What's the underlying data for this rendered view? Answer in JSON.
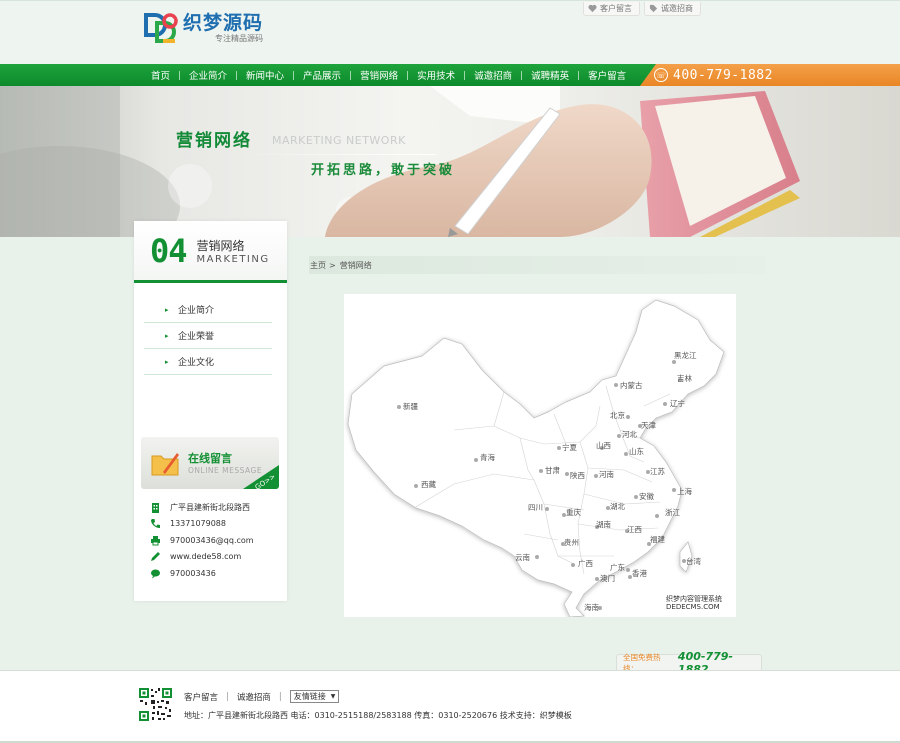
{
  "header": {
    "logo_title": "织梦源码",
    "logo_sub": "专注精品源码",
    "toplinks": [
      "客户留言",
      "诚邀招商"
    ]
  },
  "nav": {
    "items": [
      "首页",
      "企业简介",
      "新闻中心",
      "产品展示",
      "营销网络",
      "实用技术",
      "诚邀招商",
      "诚聘精英",
      "客户留言"
    ],
    "phone": "400-779-1882"
  },
  "banner": {
    "title": "营销网络",
    "title_en": "MARKETING NETWORK",
    "slogan": "开拓思路，敢于突破"
  },
  "sidebar": {
    "number": "04",
    "head_cn": "营销网络",
    "head_en": "MARKETING",
    "menu": [
      "企业简介",
      "企业荣誉",
      "企业文化"
    ],
    "message_cn": "在线留言",
    "message_en": "ONLINE MESSAGE",
    "message_go": "GO>>",
    "contact": {
      "address": "广平县建新街北段路西",
      "phone": "13371079088",
      "email": "970003436@qq.com",
      "website": "www.dede58.com",
      "qq": "970003436"
    }
  },
  "breadcrumb": {
    "home": "主页",
    "sep": ">",
    "current": "营销网络"
  },
  "map": {
    "provinces": [
      "黑龙江",
      "吉林",
      "辽宁",
      "内蒙古",
      "北京",
      "天津",
      "河北",
      "山西",
      "山东",
      "新疆",
      "青海",
      "宁夏",
      "甘肃",
      "陕西",
      "河南",
      "江苏",
      "西藏",
      "四川",
      "重庆",
      "湖北",
      "安徽",
      "上海",
      "湖南",
      "江西",
      "浙江",
      "福建",
      "贵州",
      "云南",
      "广西",
      "广东",
      "台湾",
      "澳门",
      "香港",
      "海南"
    ],
    "watermark_line1": "织梦内容管理系统",
    "watermark_line2": "DEDECMS.COM"
  },
  "footer": {
    "phone_label": "全国免费热线：",
    "phone": "400-779-1882",
    "links": [
      "客户留言",
      "诚邀招商"
    ],
    "select_label": "友情链接",
    "address_line": "地址：广平县建新街北段路西 电话：0310-2515188/2583188 传真：0310-2520676 技术支持：织梦模板"
  },
  "colors": {
    "brand_green": "#129033",
    "accent_orange": "#e98625"
  }
}
